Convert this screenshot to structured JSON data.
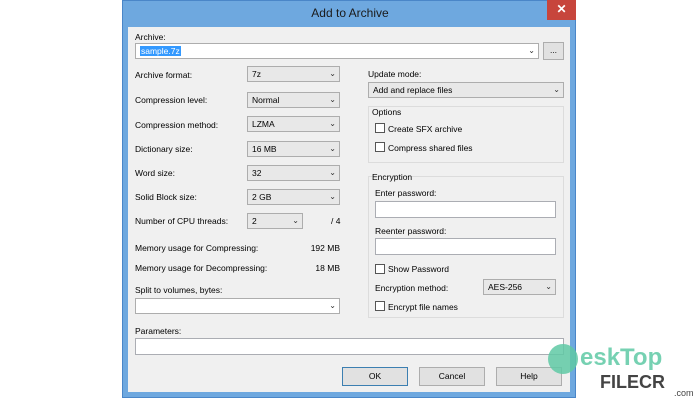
{
  "window": {
    "title": "Add to Archive",
    "close": "✕"
  },
  "archive": {
    "label": "Archive:",
    "value": "sample.7z",
    "browse": "..."
  },
  "left": {
    "rows": [
      {
        "label": "Archive format:",
        "value": "7z"
      },
      {
        "label": "Compression level:",
        "value": "Normal"
      },
      {
        "label": "Compression method:",
        "value": "LZMA"
      },
      {
        "label": "Dictionary size:",
        "value": "16 MB"
      },
      {
        "label": "Word size:",
        "value": "32"
      },
      {
        "label": "Solid Block size:",
        "value": "2 GB"
      },
      {
        "label": "Number of CPU threads:",
        "value": "2",
        "suffix": "/ 4"
      }
    ],
    "mem_compress": {
      "label": "Memory usage for Compressing:",
      "value": "192 MB"
    },
    "mem_decompress": {
      "label": "Memory usage for Decompressing:",
      "value": "18 MB"
    },
    "split": {
      "label": "Split to volumes, bytes:",
      "value": ""
    },
    "parameters": {
      "label": "Parameters:",
      "value": ""
    }
  },
  "right": {
    "update": {
      "label": "Update mode:",
      "value": "Add and replace files"
    },
    "options": {
      "title": "Options",
      "sfx": "Create SFX archive",
      "shared": "Compress shared files"
    },
    "encryption": {
      "title": "Encryption",
      "enter": "Enter password:",
      "reenter": "Reenter password:",
      "show": "Show Password",
      "method_label": "Encryption method:",
      "method": "AES-256",
      "encrypt_names": "Encrypt file names"
    }
  },
  "buttons": {
    "ok": "OK",
    "cancel": "Cancel",
    "help": "Help"
  },
  "watermark": {
    "text1": "esk",
    "text2": "Top",
    "text3": "FILECR",
    "text4": ".com"
  }
}
